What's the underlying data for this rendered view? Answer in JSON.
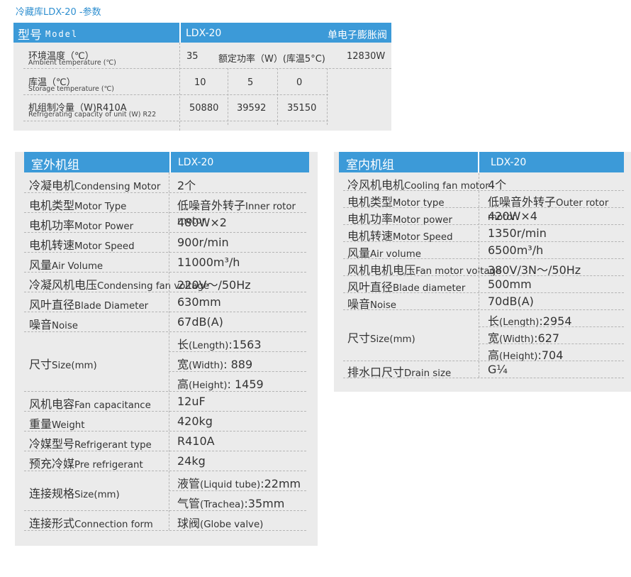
{
  "title": "冷藏库LDX-20 -参数",
  "spec": {
    "header": {
      "model_cn": "型号",
      "model_en": "Model",
      "model_value": "LDX-20",
      "valve": "单电子膨胀阀"
    },
    "ambient": {
      "cn": "环境温度（℃）",
      "en": "Ambient temperature (℃)",
      "value": "35",
      "rated_label": "额定功率（W）(库温5°C)",
      "rated_value": "12830W"
    },
    "storage": {
      "cn": "库温（℃）",
      "en": "Storage temperature (℃)",
      "values": [
        "10",
        "5",
        "0"
      ]
    },
    "capacity": {
      "cn": "机组制冷量（W)R410A",
      "en": "Refrigerating capacity of unit (W) R22",
      "values": [
        "50880",
        "39592",
        "35150"
      ]
    }
  },
  "outdoor": {
    "title": "室外机组",
    "model": "LDX-20",
    "rows": [
      {
        "cn": "冷凝电机",
        "en": "Condensing Motor",
        "value": "2个"
      },
      {
        "cn": "电机类型",
        "en": "Motor Type",
        "value": "低噪音外转子",
        "value_en": "Inner rotor motor"
      },
      {
        "cn": "电机功率",
        "en": "Motor Power",
        "value": "480W×2"
      },
      {
        "cn": "电机转速",
        "en": "Motor Speed",
        "value": "900r/min"
      },
      {
        "cn": "风量",
        "en": "Air Volume",
        "value": "11000m³/h"
      },
      {
        "cn": "冷凝风机电压",
        "en": "Condensing fan voltage",
        "value": "220V～/50Hz"
      },
      {
        "cn": "风叶直径",
        "en": "Blade Diameter",
        "value": "630mm"
      },
      {
        "cn": "噪音",
        "en": "Noise",
        "value": "67dB(A)"
      }
    ],
    "size": {
      "cn": "尺寸",
      "en": "Size(mm)",
      "lines": [
        {
          "cn": "长",
          "en": "(Length)",
          "value": ":1563"
        },
        {
          "cn": "宽",
          "en": "(Width)",
          "value": ": 889"
        },
        {
          "cn": "高",
          "en": "(Height)",
          "value": ": 1459"
        }
      ]
    },
    "rows2": [
      {
        "cn": "风机电容",
        "en": "Fan capacitance",
        "value": "12uF"
      },
      {
        "cn": "重量",
        "en": "Weight",
        "value": "420kg"
      },
      {
        "cn": "冷媒型号",
        "en": "Refrigerant type",
        "value": "R410A"
      },
      {
        "cn": "预充冷媒",
        "en": "Pre refrigerant",
        "value": "24kg"
      }
    ],
    "connection": {
      "cn": "连接规格",
      "en": "Size(mm)",
      "lines": [
        {
          "cn": "液管",
          "en": "(Liquid tube)",
          "value": ":22mm"
        },
        {
          "cn": "气管",
          "en": "(Trachea)",
          "value": ":35mm"
        }
      ]
    },
    "form": {
      "cn": "连接形式",
      "en": "Connection form",
      "value": "球阀",
      "value_en": "(Globe valve)"
    }
  },
  "indoor": {
    "title": "室内机组",
    "model": "LDX-20",
    "rows": [
      {
        "cn": "冷风机电机",
        "en": "Cooling fan motor",
        "value": "4个"
      },
      {
        "cn": "电机类型",
        "en": "Motor type",
        "value": "低噪音外转子",
        "value_en": "Outer rotor motor"
      },
      {
        "cn": "电机功率",
        "en": "Motor power",
        "value": "420W×4"
      },
      {
        "cn": "电机转速",
        "en": "Motor Speed",
        "value": "1350r/min"
      },
      {
        "cn": "风量",
        "en": "Air volume",
        "value": "6500m³/h"
      },
      {
        "cn": "风机电机电压",
        "en": "Fan motor voltage",
        "value": "380V/3N～/50Hz"
      },
      {
        "cn": "风叶直径",
        "en": "Blade diameter",
        "value": "500mm"
      },
      {
        "cn": "噪音",
        "en": "Noise",
        "value": "70dB(A)"
      }
    ],
    "size": {
      "cn": "尺寸",
      "en": "Size(mm)",
      "lines": [
        {
          "cn": "长",
          "en": "(Length)",
          "value": ":2954"
        },
        {
          "cn": "宽",
          "en": "(Width)",
          "value": ":627"
        },
        {
          "cn": "高",
          "en": "(Height)",
          "value": ":704"
        }
      ]
    },
    "drain": {
      "cn": "排水口尺寸",
      "en": "Drain size",
      "value": "G¼"
    }
  }
}
